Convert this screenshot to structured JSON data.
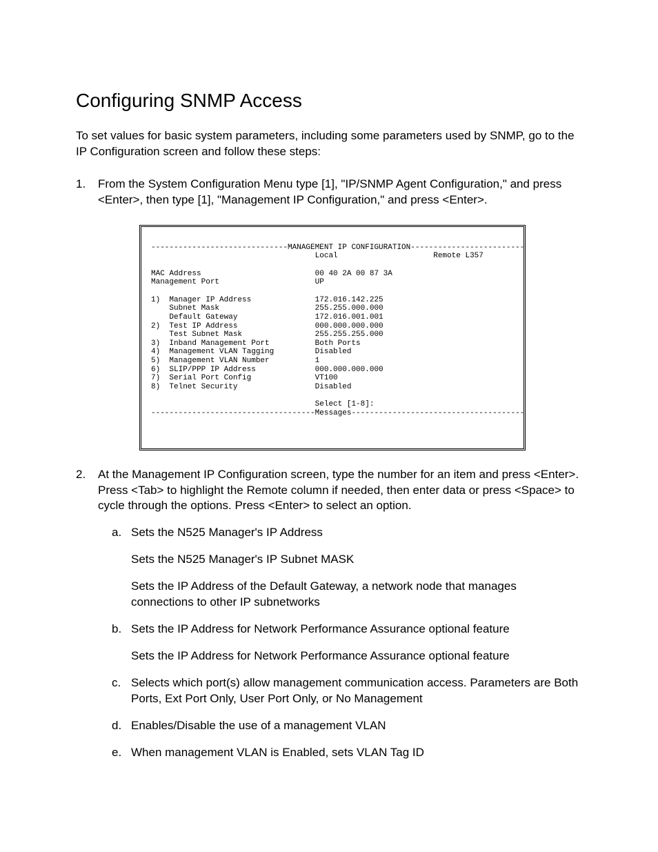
{
  "title": "Configuring SNMP Access",
  "intro": "To set values for basic system parameters, including some parameters used by SNMP, go to the IP Configuration screen and follow these steps:",
  "steps": [
    {
      "num": "1.",
      "text": "From the System Configuration Menu type [1], \"IP/SNMP Agent Configuration,\" and press <Enter>, then type [1], \"Management IP Configuration,\" and press <Enter>."
    },
    {
      "num": "2.",
      "text": "At the Management IP Configuration screen, type the number for an item and press <Enter>. Press <Tab> to highlight the Remote column if needed, then enter data or press <Space> to cycle through the options. Press <Enter> to select an option.",
      "subs": [
        {
          "let": "a.",
          "paras": [
            "Sets the N525 Manager's IP Address",
            "Sets the N525 Manager's IP Subnet MASK",
            "Sets the IP Address of the Default Gateway, a network node that manages connections to other IP subnetworks"
          ]
        },
        {
          "let": "b.",
          "paras": [
            "Sets the IP Address for Network Performance Assurance optional feature",
            "Sets the IP Address for Network Performance Assurance optional feature"
          ]
        },
        {
          "let": "c.",
          "paras": [
            "Selects which port(s) allow management communication access. Parameters are Both Ports, Ext Port Only, User Port Only, or No Management"
          ]
        },
        {
          "let": "d.",
          "paras": [
            "Enables/Disable the use of a management VLAN"
          ]
        },
        {
          "let": "e.",
          "paras": [
            "When management VLAN is Enabled, sets VLAN Tag ID"
          ]
        }
      ]
    }
  ],
  "terminal": {
    "header_label": "MANAGEMENT IP CONFIGURATION",
    "col_local": "Local",
    "col_remote": "Remote L357",
    "mac_label": "MAC Address",
    "mac_value": "00 40 2A 00 87 3A",
    "port_label": "Management Port",
    "port_value": "UP",
    "items": [
      {
        "n": "1)",
        "label": "Manager IP Address",
        "value": "172.016.142.225"
      },
      {
        "n": "  ",
        "label": "Subnet Mask",
        "value": "255.255.000.000"
      },
      {
        "n": "  ",
        "label": "Default Gateway",
        "value": "172.016.001.001"
      },
      {
        "n": "2)",
        "label": "Test IP Address",
        "value": "000.000.000.000"
      },
      {
        "n": "  ",
        "label": "Test Subnet Mask",
        "value": "255.255.255.000"
      },
      {
        "n": "3)",
        "label": "Inband Management Port",
        "value": "Both Ports"
      },
      {
        "n": "4)",
        "label": "Management VLAN Tagging",
        "value": "Disabled"
      },
      {
        "n": "5)",
        "label": "Management VLAN Number",
        "value": "1"
      },
      {
        "n": "6)",
        "label": "SLIP/PPP IP Address",
        "value": "000.000.000.000"
      },
      {
        "n": "7)",
        "label": "Serial Port Config",
        "value": "VT100"
      },
      {
        "n": "8)",
        "label": "Telnet Security",
        "value": "Disabled"
      }
    ],
    "select_prompt": "Select [1-8]:",
    "messages_label": "Messages"
  }
}
